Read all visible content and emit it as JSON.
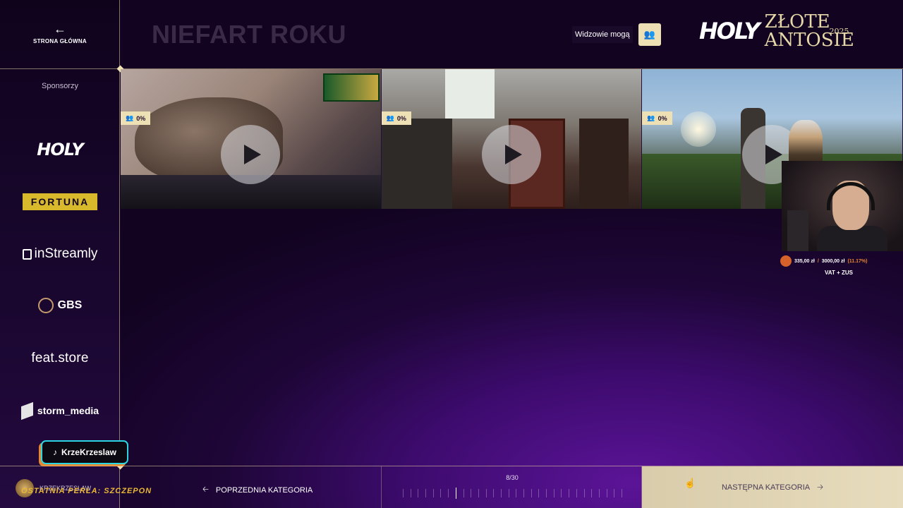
{
  "nav": {
    "home_label": "STRONA GŁÓWNA"
  },
  "sidebar": {
    "sponsors_label": "Sponsorzy",
    "sponsors": [
      "HOLY",
      "FORTUNA",
      "inStreamly",
      "GBS",
      "feat.store",
      "storm_media"
    ]
  },
  "header": {
    "title": "NIEFART ROKU",
    "viewers_label": "Widzowie mogą",
    "brand_holy": "HOLY",
    "brand_zlote": "ZŁOTE",
    "brand_antosie": "ANTOSIE",
    "brand_year": "2025"
  },
  "videos": [
    {
      "percent": "0%"
    },
    {
      "percent": "0%"
    },
    {
      "percent": "0%"
    }
  ],
  "overlay": {
    "goal_current": "335,00 zł",
    "goal_sep": "/",
    "goal_total": "3000,00 zł",
    "goal_percent": "(11.17%)",
    "goal_label": "VAT + ZUS",
    "tiktok_handle": "KrzeKrzeslaw"
  },
  "footer": {
    "username": "KRZEKRZESLAW",
    "pearl_text": "OSTATNIA PERŁA: SZCZEPON",
    "prev_label": "POPRZEDNIA KATEGORIA",
    "progress_text": "8/30",
    "progress": {
      "current": 8,
      "total": 30
    },
    "next_label": "NASTĘPNA KATEGORIA"
  },
  "colors": {
    "accent_gold": "#eee0b5",
    "background": "#1e0637",
    "border": "#e6d2a0"
  }
}
